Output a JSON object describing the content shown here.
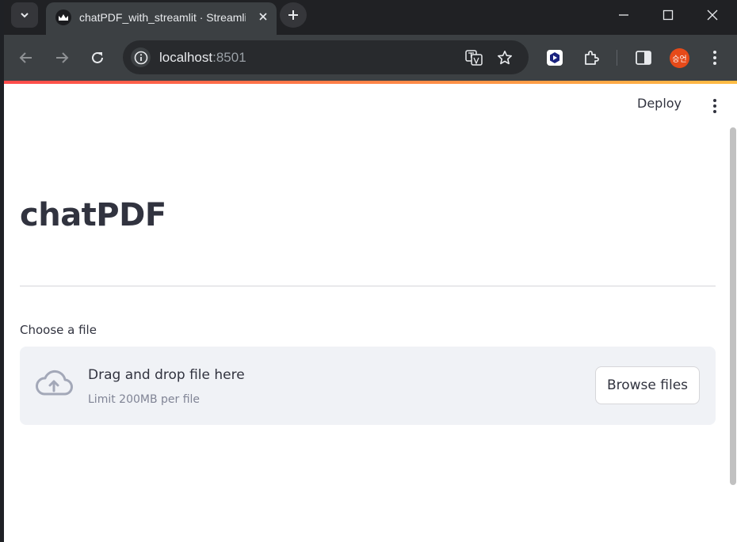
{
  "browser": {
    "tab_title": "chatPDF_with_streamlit · Streamlit",
    "url_host": "localhost",
    "url_port": ":8501",
    "profile_initials": "승언",
    "icons": {
      "tab_search": "chevron-down-icon",
      "favicon": "streamlit-crown-icon",
      "close_tab": "close-icon",
      "new_tab": "plus-icon",
      "back": "arrow-left-icon",
      "forward": "arrow-right-icon",
      "reload": "reload-icon",
      "site_info": "info-icon",
      "translate": "translate-icon",
      "bookmark": "star-icon",
      "extension_app": "extension-app-icon",
      "extensions": "puzzle-icon",
      "side_panel": "side-panel-icon",
      "menu": "kebab-menu-icon"
    }
  },
  "app": {
    "deploy_label": "Deploy",
    "title": "chatPDF",
    "uploader": {
      "label": "Choose a file",
      "drop_text": "Drag and drop file here",
      "limit_text": "Limit 200MB per file",
      "browse_label": "Browse files"
    }
  },
  "colors": {
    "accent_gradient_start": "#ff4b4b",
    "accent_gradient_end": "#ffbd45",
    "text_primary": "#31333f",
    "dropzone_bg": "#f0f2f6",
    "profile_avatar": "#e64a19"
  }
}
